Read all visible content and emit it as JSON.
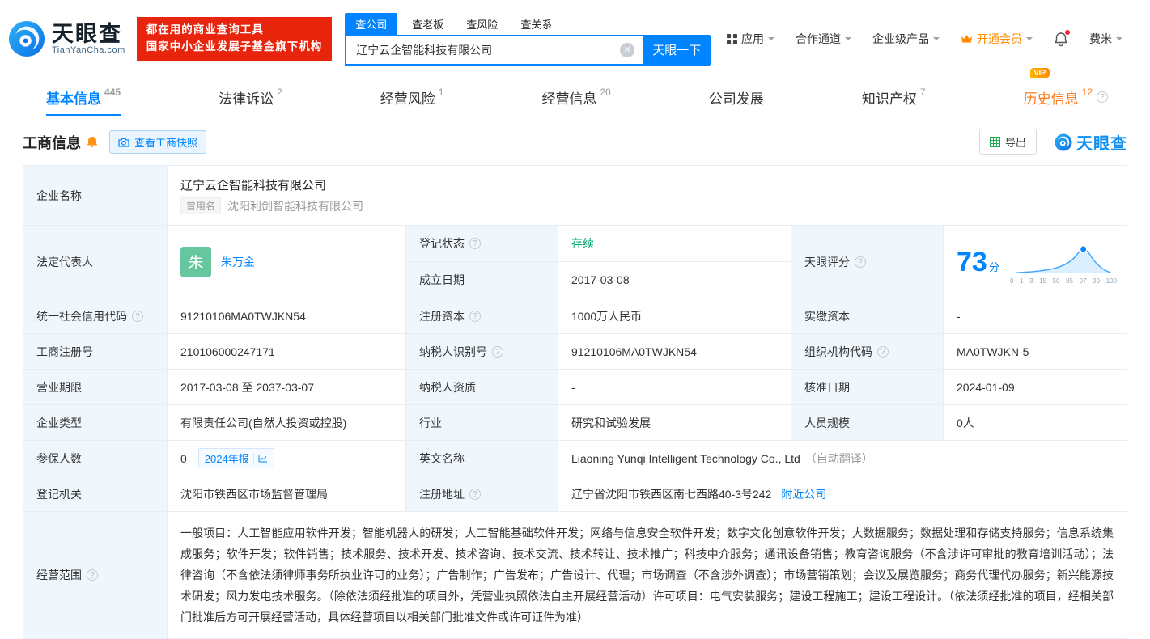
{
  "colors": {
    "accent": "#0084ff",
    "logo_red": "#e8240c",
    "vip_orange": "#ff7a1c",
    "status_green": "#00a870",
    "avatar_green": "#66c69e",
    "export_green": "#1faa53"
  },
  "header": {
    "brand": "天眼查",
    "brand_domain": "TianYanCha.com",
    "slogan_line1": "都在用的商业查询工具",
    "slogan_line2": "国家中小企业发展子基金旗下机构",
    "search_tabs": [
      {
        "label": "查公司"
      },
      {
        "label": "查老板"
      },
      {
        "label": "查风险"
      },
      {
        "label": "查关系"
      }
    ],
    "search_value": "辽宁云企智能科技有限公司",
    "search_button": "天眼一下",
    "nav_apps": "应用",
    "nav_coop": "合作通道",
    "nav_enterprise": "企业级产品",
    "nav_vip": "开通会员",
    "nav_user": "费米"
  },
  "tabs": {
    "basic": {
      "label": "基本信息",
      "count": "445"
    },
    "legal": {
      "label": "法律诉讼",
      "count": "2"
    },
    "risk": {
      "label": "经营风险",
      "count": "1"
    },
    "business": {
      "label": "经营信息",
      "count": "20"
    },
    "development": {
      "label": "公司发展",
      "count": ""
    },
    "ip": {
      "label": "知识产权",
      "count": "7"
    },
    "history": {
      "label": "历史信息",
      "count": "12",
      "vip": "VIP"
    }
  },
  "section": {
    "title": "工商信息",
    "snapshot": "查看工商快照",
    "export": "导出",
    "watermark": "天眼查"
  },
  "info": {
    "name_label": "企业名称",
    "name": "辽宁云企智能科技有限公司",
    "former_tag": "曾用名",
    "former_name": "沈阳利剑智能科技有限公司",
    "legal_label": "法定代表人",
    "legal_avatar": "朱",
    "legal_name": "朱万金",
    "status_label": "登记状态",
    "status": "存续",
    "established_label": "成立日期",
    "established": "2017-03-08",
    "score_label": "天眼评分",
    "score": "73",
    "score_unit": "分",
    "uscc_label": "统一社会信用代码",
    "uscc": "91210106MA0TWJKN54",
    "capital_label": "注册资本",
    "capital": "1000万人民币",
    "paid_label": "实缴资本",
    "paid": "-",
    "regno_label": "工商注册号",
    "regno": "210106000247171",
    "taxid_label": "纳税人识别号",
    "taxid": "91210106MA0TWJKN54",
    "orgcode_label": "组织机构代码",
    "orgcode": "MA0TWJKN-5",
    "term_label": "营业期限",
    "term": "2017-03-08 至 2037-03-07",
    "taxqual_label": "纳税人资质",
    "taxqual": "-",
    "approved_label": "核准日期",
    "approved": "2024-01-09",
    "type_label": "企业类型",
    "type": "有限责任公司(自然人投资或控股)",
    "industry_label": "行业",
    "industry": "研究和试验发展",
    "staff_label": "人员规模",
    "staff": "0人",
    "insured_label": "参保人数",
    "insured": "0",
    "annual_report": "2024年报",
    "en_label": "英文名称",
    "en_name": "Liaoning Yunqi Intelligent Technology Co., Ltd",
    "en_note": "（自动翻译）",
    "authority_label": "登记机关",
    "authority": "沈阳市铁西区市场监督管理局",
    "address_label": "注册地址",
    "address": "辽宁省沈阳市铁西区南七西路40-3号242",
    "nearby": "附近公司",
    "scope_label": "经营范围",
    "scope": "一般项目：人工智能应用软件开发；智能机器人的研发；人工智能基础软件开发；网络与信息安全软件开发；数字文化创意软件开发；大数据服务；数据处理和存储支持服务；信息系统集成服务；软件开发；软件销售；技术服务、技术开发、技术咨询、技术交流、技术转让、技术推广；科技中介服务；通讯设备销售；教育咨询服务（不含涉许可审批的教育培训活动）；法律咨询（不含依法须律师事务所执业许可的业务）；广告制作；广告发布；广告设计、代理；市场调查（不含涉外调查）；市场营销策划；会议及展览服务；商务代理代办服务；新兴能源技术研发；风力发电技术服务。（除依法须经批准的项目外，凭营业执照依法自主开展经营活动）许可项目：电气安装服务；建设工程施工；建设工程设计。（依法须经批准的项目，经相关部门批准后方可开展经营活动，具体经营项目以相关部门批准文件或许可证件为准）"
  },
  "score_chart": {
    "type": "area",
    "ticks": [
      "0",
      "1",
      "3",
      "15",
      "50",
      "85",
      "97",
      "99",
      "100"
    ],
    "score": 73,
    "max": 100
  }
}
